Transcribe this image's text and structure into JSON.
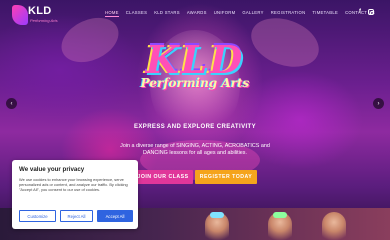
{
  "brand": {
    "logo_text": "KLD",
    "logo_sub": "Performing Arts",
    "hero_title": "KLD",
    "hero_script": "Performing Arts"
  },
  "nav": {
    "items": [
      {
        "label": "HOME",
        "active": true
      },
      {
        "label": "CLASSES",
        "active": false
      },
      {
        "label": "KLD STARS",
        "active": false
      },
      {
        "label": "AWARDS",
        "active": false
      },
      {
        "label": "UNIFORM",
        "active": false
      },
      {
        "label": "GALLERY",
        "active": false
      },
      {
        "label": "REGISTRATION",
        "active": false
      },
      {
        "label": "TIMETABLE",
        "active": false
      },
      {
        "label": "CONTACT US",
        "active": false
      }
    ],
    "social": {
      "facebook": "f"
    }
  },
  "hero": {
    "tagline": "EXPRESS AND EXPLORE CREATIVITY",
    "description": "Join a diverse range of SINGING, ACTING, ACROBATICS and DANCING lessons for all ages and abilities.",
    "join_label": "JOIN OUR CLASS",
    "register_label": "REGISTER TODAY",
    "prev_arrow": "‹",
    "next_arrow": "›"
  },
  "cookie": {
    "title": "We value your privacy",
    "text": "We use cookies to enhance your browsing experience, serve personalized ads or content, and analyze our traffic. By clicking \"Accept All\", you consent to our use of cookies.",
    "customize_label": "Customize",
    "reject_label": "Reject All",
    "accept_label": "Accept All"
  },
  "colors": {
    "accent_pink": "#e0369a",
    "accent_orange": "#f5a41c",
    "cookie_blue": "#2f64e0"
  }
}
